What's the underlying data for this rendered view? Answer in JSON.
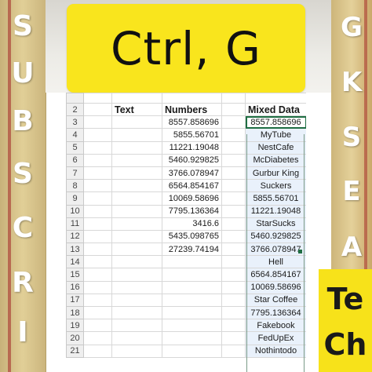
{
  "banner": {
    "text": "Ctrl, G"
  },
  "left_letters": [
    "S",
    "U",
    "B",
    "S",
    "C",
    "R",
    "I"
  ],
  "right_letters": [
    "G",
    "K",
    "S",
    "E",
    "A"
  ],
  "tech_letters": [
    "Te",
    "Ch"
  ],
  "colors": {
    "banner": "#f9e51d",
    "side_gold": "#e1cf97",
    "selection": "#e9f1fb",
    "active_border": "#1f6e43"
  },
  "sheet": {
    "headers": {
      "text": "Text",
      "numbers": "Numbers",
      "mixed": "Mixed Data"
    },
    "rows": [
      {
        "n": "2",
        "numbers": "",
        "mixed": ""
      },
      {
        "n": "3",
        "numbers": "8557.858696",
        "mixed": "8557.858696"
      },
      {
        "n": "4",
        "numbers": "5855.56701",
        "mixed": "MyTube"
      },
      {
        "n": "5",
        "numbers": "11221.19048",
        "mixed": "NestCafe"
      },
      {
        "n": "6",
        "numbers": "5460.929825",
        "mixed": "McDiabetes"
      },
      {
        "n": "7",
        "numbers": "3766.078947",
        "mixed": "Gurbur King"
      },
      {
        "n": "8",
        "numbers": "6564.854167",
        "mixed": "Suckers"
      },
      {
        "n": "9",
        "numbers": "10069.58696",
        "mixed": "5855.56701"
      },
      {
        "n": "10",
        "numbers": "7795.136364",
        "mixed": "11221.19048"
      },
      {
        "n": "11",
        "numbers": "3416.6",
        "mixed": "StarSucks"
      },
      {
        "n": "12",
        "numbers": "5435.098765",
        "mixed": "5460.929825"
      },
      {
        "n": "13",
        "numbers": "27239.74194",
        "mixed": "3766.078947"
      },
      {
        "n": "14",
        "numbers": "",
        "mixed": "Hell"
      },
      {
        "n": "15",
        "numbers": "",
        "mixed": "6564.854167"
      },
      {
        "n": "16",
        "numbers": "",
        "mixed": "10069.58696"
      },
      {
        "n": "17",
        "numbers": "",
        "mixed": "Star Coffee"
      },
      {
        "n": "18",
        "numbers": "",
        "mixed": "7795.136364"
      },
      {
        "n": "19",
        "numbers": "",
        "mixed": "Fakebook"
      },
      {
        "n": "20",
        "numbers": "",
        "mixed": "FedUpEx"
      },
      {
        "n": "21",
        "numbers": "",
        "mixed": "Nothintodo"
      }
    ]
  }
}
